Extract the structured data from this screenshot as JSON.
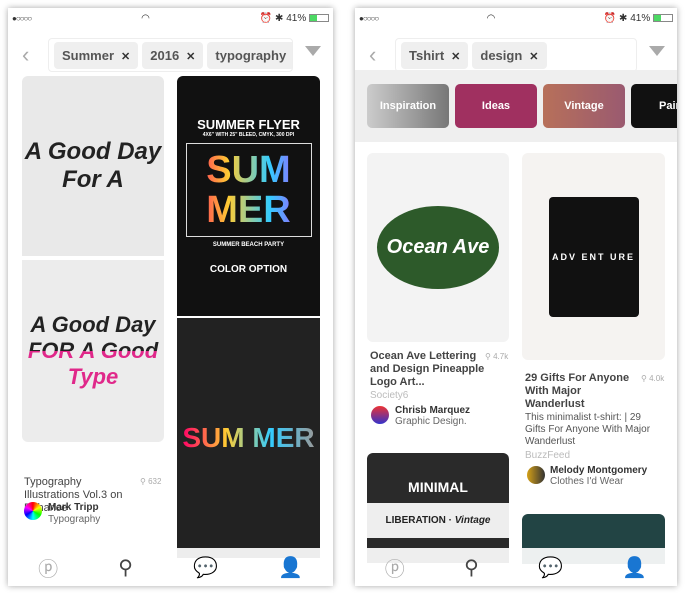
{
  "status": {
    "signal": "●○○○○",
    "wifi": "wifi",
    "time_icons": "⏰ ✱",
    "battery": "41%"
  },
  "screen1": {
    "chips": [
      {
        "label": "Summer"
      },
      {
        "label": "2016"
      },
      {
        "label": "typography"
      }
    ],
    "flyer": {
      "title": "SUMMER FLYER",
      "sub": "4X6\" WITH 25\" BLEED, CMYK, 300 DPI",
      "big": "SUM MER",
      "party": "SUMMER BEACH PARTY",
      "option": "COLOR OPTION"
    },
    "art": {
      "a": "A Good Day For A",
      "b": "A Good Day FOR A Good Type"
    },
    "pin": {
      "title": "Typography Illustrations Vol.3 on Behance",
      "saves": "632",
      "user": "Mark Tripp",
      "board": "Typography"
    }
  },
  "screen2": {
    "chips": [
      {
        "label": "Tshirt"
      },
      {
        "label": "design"
      }
    ],
    "categories": [
      {
        "label": "Inspiration"
      },
      {
        "label": "Ideas"
      },
      {
        "label": "Vintage"
      },
      {
        "label": "Pain"
      }
    ],
    "pin1": {
      "title": "Ocean Ave Lettering and Design Pineapple Logo Art...",
      "saves": "4.7k",
      "source": "Society6",
      "user": "Chrisb Marquez",
      "board": "Graphic Design.",
      "art": "Ocean Ave"
    },
    "pin2": {
      "title": "29 Gifts For Anyone With Major Wanderlust",
      "saves": "4.0k",
      "desc": "This minimalist t-shirt: | 29 Gifts For Anyone With Major Wanderlust",
      "source": "BuzzFeed",
      "user": "Melody Montgomery",
      "board": "Clothes I'd Wear",
      "art": "ADV ENT URE"
    },
    "pin3": {
      "art1": "MINIMAL",
      "art2": "LIBERATION",
      "art3": "Vintage"
    }
  },
  "tabs": [
    {
      "icon": "pinterest-icon"
    },
    {
      "icon": "search-icon"
    },
    {
      "icon": "chat-icon"
    },
    {
      "icon": "profile-icon"
    }
  ]
}
